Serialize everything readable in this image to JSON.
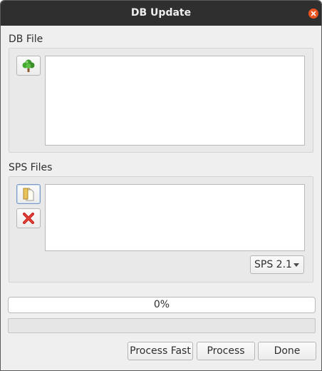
{
  "window": {
    "title": "DB Update"
  },
  "db_file": {
    "label": "DB File",
    "browse_icon": "tree-icon"
  },
  "sps_files": {
    "label": "SPS Files",
    "add_icon": "open-files-icon",
    "remove_icon": "red-x-icon",
    "version": {
      "selected": "SPS 2.1"
    }
  },
  "progress": {
    "text": "0%",
    "value": 0
  },
  "buttons": {
    "process_fast": "Process Fast",
    "process": "Process",
    "done": "Done"
  },
  "colors": {
    "titlebar": "#2f2f2f",
    "close": "#e95420",
    "window_bg": "#efefef"
  }
}
